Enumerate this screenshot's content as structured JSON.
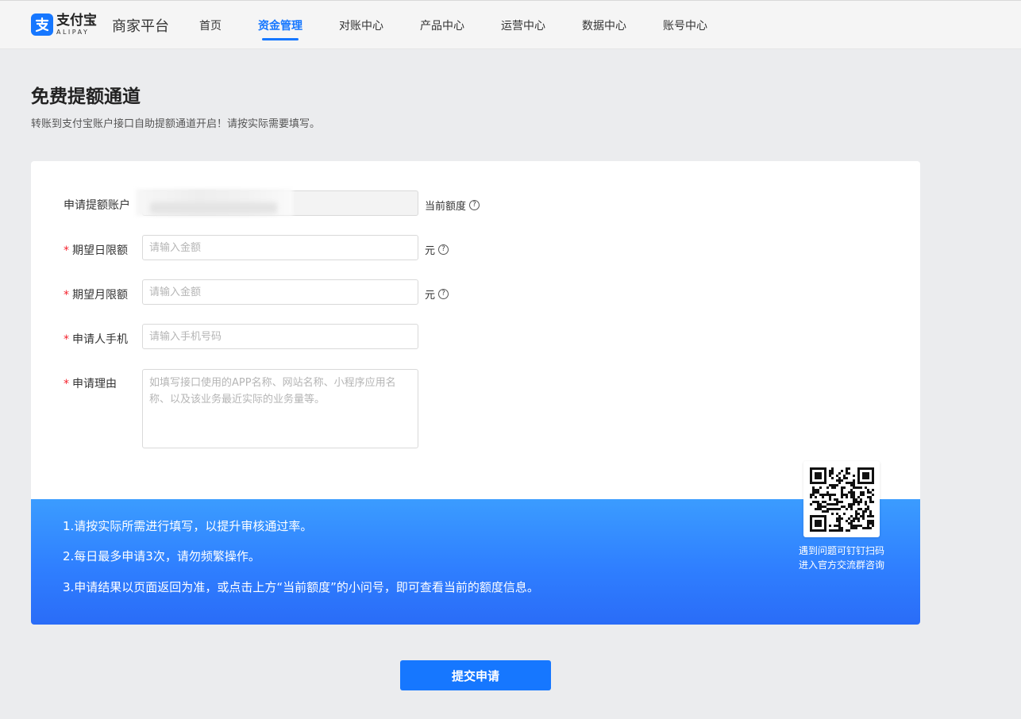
{
  "header": {
    "logo_cn": "支付宝",
    "logo_en": "ALIPAY",
    "platform": "商家平台",
    "nav": [
      {
        "label": "首页",
        "active": false
      },
      {
        "label": "资金管理",
        "active": true
      },
      {
        "label": "对账中心",
        "active": false
      },
      {
        "label": "产品中心",
        "active": false
      },
      {
        "label": "运营中心",
        "active": false
      },
      {
        "label": "数据中心",
        "active": false
      },
      {
        "label": "账号中心",
        "active": false
      }
    ]
  },
  "page": {
    "title": "免费提额通道",
    "subtitle": "转账到支付宝账户接口自助提额通道开启！请按实际需要填写。"
  },
  "form": {
    "account": {
      "label": "申请提额账户",
      "suffix": "当前额度"
    },
    "daily": {
      "label": "期望日限额",
      "placeholder": "请输入金额",
      "suffix": "元"
    },
    "monthly": {
      "label": "期望月限额",
      "placeholder": "请输入金额",
      "suffix": "元"
    },
    "phone": {
      "label": "申请人手机",
      "placeholder": "请输入手机号码"
    },
    "reason": {
      "label": "申请理由",
      "placeholder": "如填写接口使用的APP名称、网站名称、小程序应用名称、以及该业务最近实际的业务量等。"
    },
    "required_mark": "*",
    "help_glyph": "?"
  },
  "tips": [
    "1.请按实际所需进行填写，以提升审核通过率。",
    "2.每日最多申请3次，请勿频繁操作。",
    "3.申请结果以页面返回为准，或点击上方“当前额度”的小问号，即可查看当前的额度信息。"
  ],
  "qr": {
    "caption_line1": "遇到问题可钉钉扫码",
    "caption_line2": "进入官方交流群咨询"
  },
  "submit_label": "提交申请",
  "colors": {
    "brand": "#1677ff",
    "required": "#f5222d",
    "banner_top": "#3b9cff",
    "banner_bottom": "#2a6cf7"
  }
}
